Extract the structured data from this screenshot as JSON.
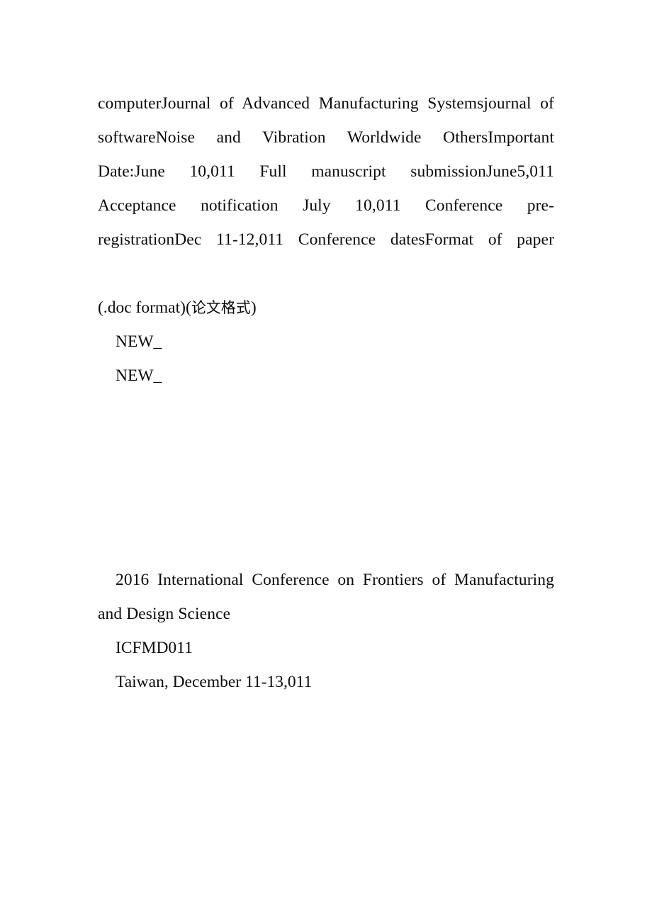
{
  "document": {
    "page_background": "#ffffff",
    "text_color": "#0b0b0b",
    "body_blocks": {
      "schedule_paragraph": "computerJournal of Advanced Manufacturing Systemsjournal of softwareNoise and Vibration Worldwide OthersImportant Date:June 10,011 Full manuscript submissionJune5,011 Acceptance notification July 10,011 Conference pre-registrationDec 11-12,011 Conference datesFormat of paper",
      "format_line_latin": "(.doc format)(",
      "format_line_cjk": "论文格式",
      "format_line_close": ")",
      "new_marker_1": "NEW_",
      "new_marker_2": "NEW_",
      "conference_title": "2016 International Conference on Frontiers of Manufacturing and Design Science",
      "conference_code": "ICFMD011",
      "conference_location_dates": "Taiwan, December 11-13,011"
    }
  }
}
